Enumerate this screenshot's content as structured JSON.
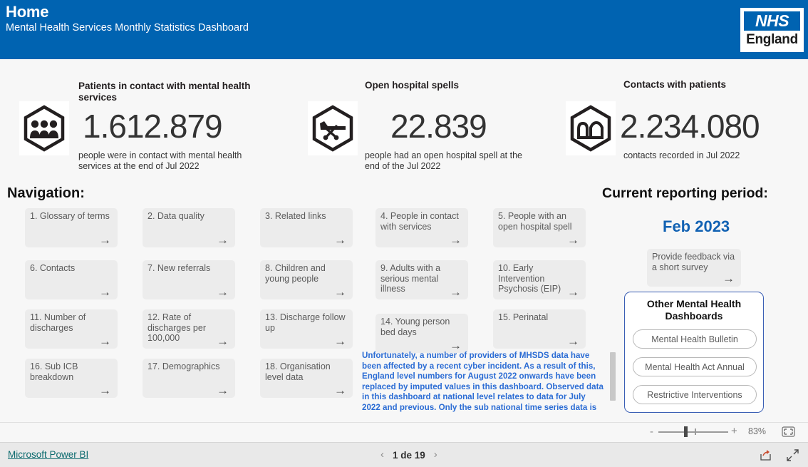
{
  "header": {
    "title": "Home",
    "subtitle": "Mental Health Services Monthly Statistics Dashboard",
    "logo_nhs": "NHS",
    "logo_england": "England",
    "bg_color": "#0063b1"
  },
  "kpis": [
    {
      "icon": "people-hexagon-icon",
      "title": "Patients in contact with mental health services",
      "value": "1.612.879",
      "description": "people were in contact with mental health services at the end of Jul 2022"
    },
    {
      "icon": "hospital-bed-hexagon-icon",
      "title": "Open hospital spells",
      "value": "22.839",
      "description": "people had an open hospital spell at the end of the Jul 2022"
    },
    {
      "icon": "contacts-hexagon-icon",
      "title": "Contacts with patients",
      "value": "2.234.080",
      "description": "contacts recorded in Jul 2022"
    }
  ],
  "navigation": {
    "heading": "Navigation:",
    "arrow_glyph": "→",
    "items": [
      {
        "label": "1. Glossary of terms"
      },
      {
        "label": "2. Data quality"
      },
      {
        "label": "3. Related links"
      },
      {
        "label": "4. People in contact with services"
      },
      {
        "label": "5. People with an open hospital spell"
      },
      {
        "label": "6. Contacts"
      },
      {
        "label": "7. New referrals"
      },
      {
        "label": "8. Children and young people"
      },
      {
        "label": "9. Adults with a serious mental illness"
      },
      {
        "label": "10. Early Intervention Psychosis (EIP)"
      },
      {
        "label": "11. Number of discharges"
      },
      {
        "label": "12. Rate of discharges per 100,000"
      },
      {
        "label": "13. Discharge follow up"
      },
      {
        "label": "14. Young person bed days"
      },
      {
        "label": "15. Perinatal"
      },
      {
        "label": "16. Sub ICB breakdown"
      },
      {
        "label": "17. Demographics"
      },
      {
        "label": "18. Organisation level data"
      }
    ]
  },
  "notice": {
    "text": "Unfortunately, a number of providers of MHSDS data have been affected by a recent cyber incident.  As a result of this, England level numbers for August 2022 onwards have been replaced by imputed values in this dashboard. Observed data in this dashboard at national level relates to data for July 2022 and previous. Only the sub national time series data is updated for",
    "color": "#2b6cd4"
  },
  "reporting": {
    "title": "Current reporting period:",
    "period": "Feb 2023",
    "period_color": "#1262b3"
  },
  "feedback": {
    "label": "Provide feedback via a short survey",
    "arrow_glyph": "→"
  },
  "other_dashboards": {
    "title": "Other Mental Health Dashboards",
    "buttons": [
      {
        "label": "Mental Health Bulletin"
      },
      {
        "label": "Mental Health Act Annual"
      },
      {
        "label": "Restrictive Interventions"
      }
    ],
    "border_color": "#3b5fb5"
  },
  "zoombar": {
    "minus": "-",
    "plus": "+",
    "percent": "83%",
    "fit_icon": "fit-to-page-icon"
  },
  "footer": {
    "link": "Microsoft Power BI",
    "link_color": "#0b6a6e",
    "page_label": "1 de 19",
    "prev_glyph": "‹",
    "next_glyph": "›",
    "share_icon": "share-icon",
    "fullscreen_icon": "fullscreen-icon"
  }
}
